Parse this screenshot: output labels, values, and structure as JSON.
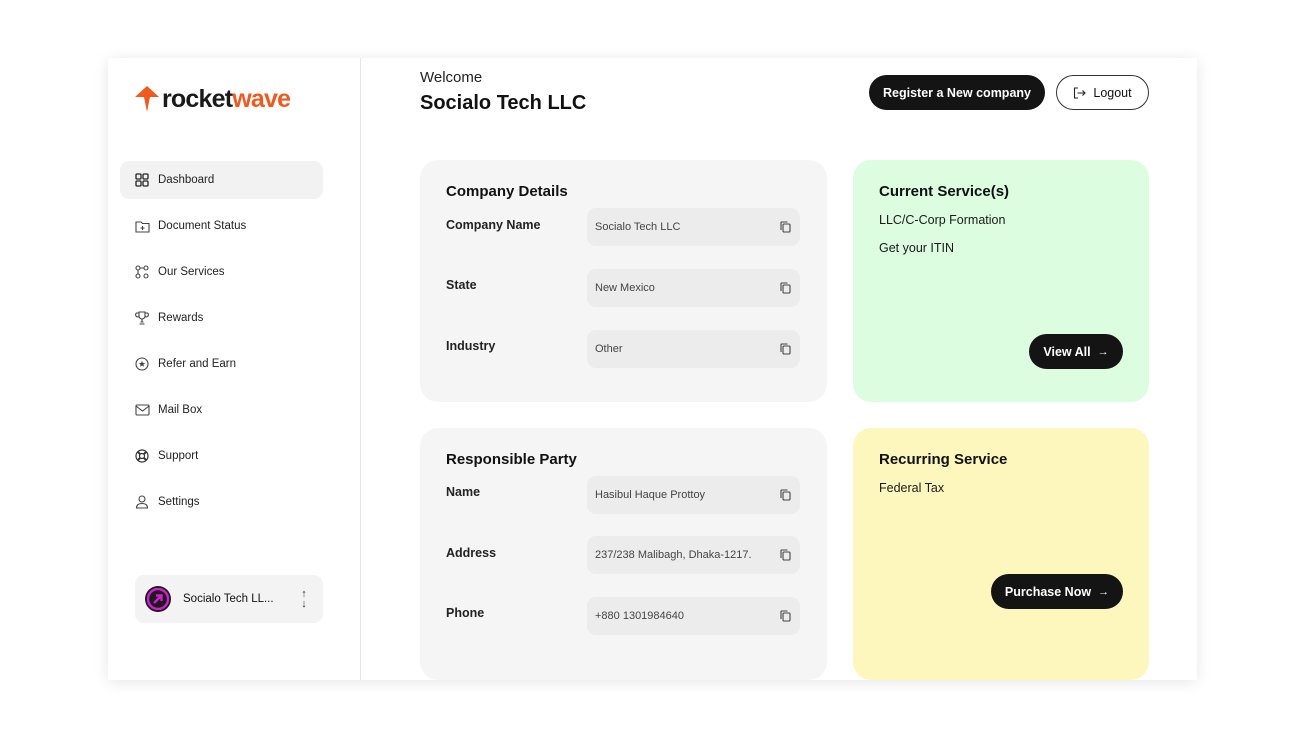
{
  "brand": {
    "name_part1": "rocket",
    "name_part2": "wave",
    "accent_color": "#f05a1e"
  },
  "sidebar": {
    "items": [
      {
        "label": "Dashboard",
        "icon": "grid-icon",
        "active": true
      },
      {
        "label": "Document Status",
        "icon": "folder-icon"
      },
      {
        "label": "Our Services",
        "icon": "nodes-icon"
      },
      {
        "label": "Rewards",
        "icon": "trophy-icon"
      },
      {
        "label": "Refer and Earn",
        "icon": "star-badge-icon"
      },
      {
        "label": "Mail Box",
        "icon": "mail-icon"
      },
      {
        "label": "Support",
        "icon": "lifebuoy-icon"
      },
      {
        "label": "Settings",
        "icon": "user-icon"
      }
    ],
    "account": {
      "name": "Socialo Tech LL..."
    }
  },
  "header": {
    "welcome": "Welcome",
    "company": "Socialo Tech LLC",
    "register_label": "Register a New company",
    "logout_label": "Logout"
  },
  "company_details": {
    "title": "Company Details",
    "fields": [
      {
        "label": "Company Name",
        "value": "Socialo Tech LLC"
      },
      {
        "label": "State",
        "value": "New Mexico"
      },
      {
        "label": "Industry",
        "value": "Other"
      }
    ]
  },
  "responsible_party": {
    "title": "Responsible Party",
    "fields": [
      {
        "label": "Name",
        "value": "Hasibul Haque Prottoy"
      },
      {
        "label": "Address",
        "value": "237/238 Malibagh, Dhaka-1217."
      },
      {
        "label": "Phone",
        "value": "+880 1301984640"
      }
    ]
  },
  "current_services": {
    "title": "Current Service(s)",
    "items": [
      "LLC/C-Corp Formation",
      "Get your ITIN"
    ],
    "button_label": "View All",
    "color": "#dcfde0"
  },
  "recurring_service": {
    "title": "Recurring Service",
    "items": [
      "Federal Tax"
    ],
    "button_label": "Purchase Now",
    "color": "#fef7bd"
  }
}
